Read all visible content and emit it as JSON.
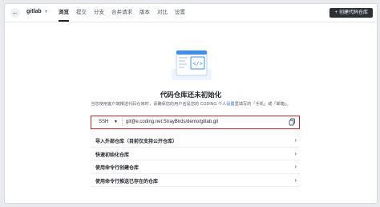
{
  "header": {
    "back_icon": "arrow-left-icon",
    "repo_name": "gitlab",
    "tabs": [
      {
        "label": "浏览",
        "active": true
      },
      {
        "label": "提交",
        "active": false
      },
      {
        "label": "分支",
        "active": false
      },
      {
        "label": "合并请求",
        "active": false
      },
      {
        "label": "版本",
        "active": false
      },
      {
        "label": "对比",
        "active": false
      },
      {
        "label": "设置",
        "active": false
      }
    ],
    "create_button": "创建代码仓库"
  },
  "main": {
    "title": "代码仓库还未初始化",
    "description_before": "当您使用客户端推送代码仓库时，请确保您的用户名是您的 CODING 个人",
    "description_link": "设置",
    "description_after": "里填写的「手机」或「邮箱」。",
    "clone": {
      "protocol": "SSH",
      "url": "git@e.coding.net:StrayBirds/demo/gitlab.git"
    },
    "options": [
      "导入外部仓库（目前仅支持公开仓库）",
      "快速初始化仓库",
      "使用命令行创建仓库",
      "使用命令行推送已存在的仓库"
    ]
  },
  "colors": {
    "accent_dark": "#2b2f36",
    "highlight_border": "#c8242f",
    "link": "#2d6ad2",
    "illustration_blue": "#3f8ee8"
  }
}
